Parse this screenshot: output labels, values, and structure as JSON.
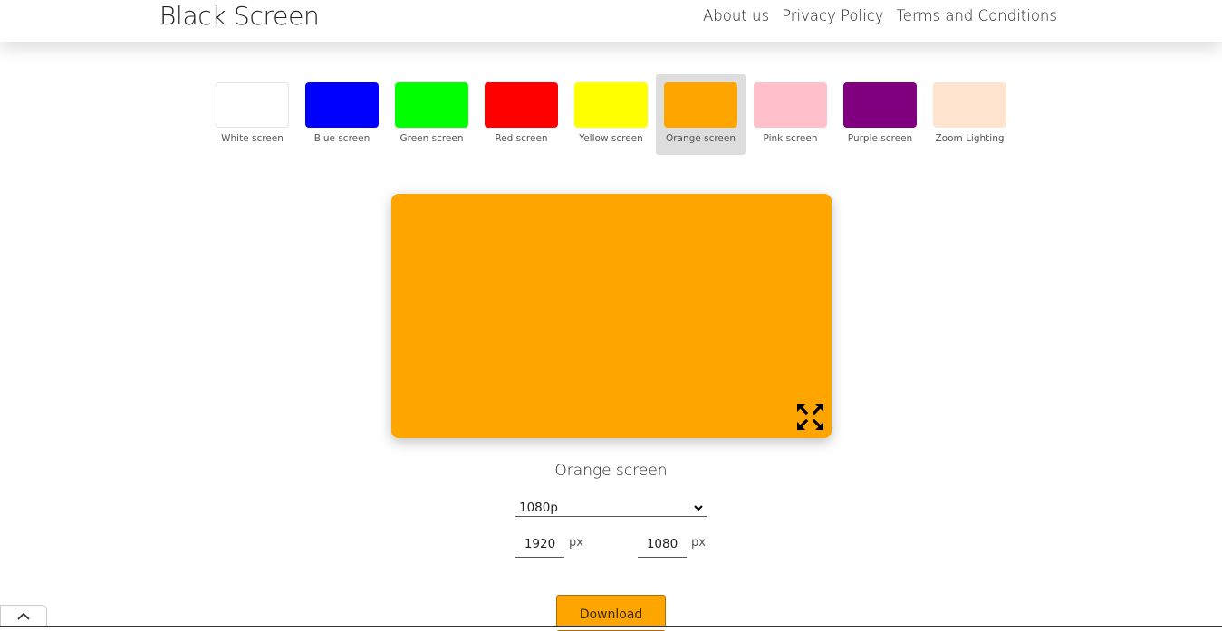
{
  "header": {
    "logo": "Black Screen",
    "nav": [
      "About us",
      "Privacy Policy",
      "Terms and Conditions"
    ]
  },
  "swatches": [
    {
      "label": "White screen",
      "color": "#ffffff"
    },
    {
      "label": "Blue screen",
      "color": "#0000ff"
    },
    {
      "label": "Green screen",
      "color": "#00ff00"
    },
    {
      "label": "Red screen",
      "color": "#ff0000"
    },
    {
      "label": "Yellow screen",
      "color": "#ffff00"
    },
    {
      "label": "Orange screen",
      "color": "#ffa500",
      "selected": true
    },
    {
      "label": "Pink screen",
      "color": "#ffc0cb"
    },
    {
      "label": "Purple screen",
      "color": "#800080"
    },
    {
      "label": "Zoom Lighting",
      "color": "#ffe5cf"
    }
  ],
  "preview": {
    "color": "#ffa500",
    "title": "Orange screen",
    "fullscreen_icon": "expand-arrows-icon"
  },
  "resolution": {
    "selected": "1080p",
    "width": "1920",
    "height": "1080",
    "unit": "px"
  },
  "download_label": "Download",
  "scroll_top_icon": "chevron-up-icon"
}
